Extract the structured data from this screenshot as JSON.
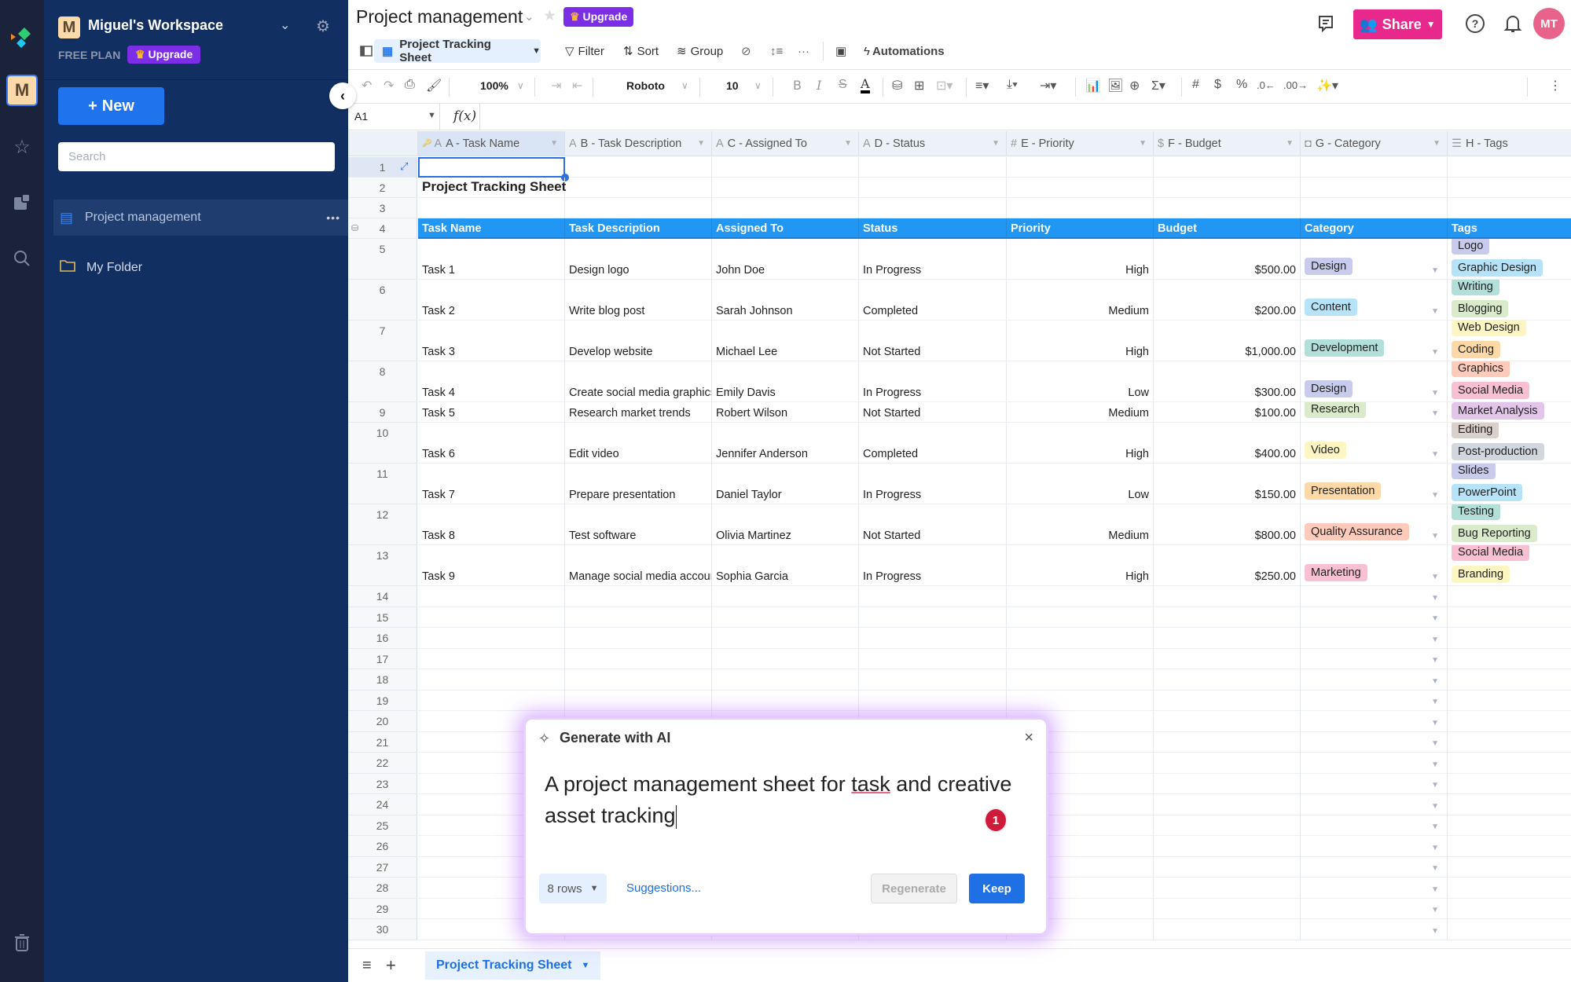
{
  "rail": {
    "logo_icon": "app-logo-icon",
    "workspace_initial": "M",
    "icons": [
      "star-icon",
      "puzzle-icon",
      "search-icon",
      "trash-icon"
    ]
  },
  "sidebar": {
    "workspace_initial": "M",
    "workspace_name": "Miguel's Workspace",
    "plan": "FREE PLAN",
    "upgrade_label": "Upgrade",
    "new_label": "New",
    "search_placeholder": "Search",
    "items": [
      {
        "label": "Project management",
        "icon": "book-icon",
        "selected": true,
        "more": "•••"
      },
      {
        "label": "My Folder",
        "icon": "folder-icon",
        "selected": false
      }
    ]
  },
  "header": {
    "title": "Project management",
    "upgrade_label": "Upgrade",
    "share_label": "Share",
    "avatar_initials": "MT",
    "colors": {
      "share": "#e8288c",
      "upgrade": "#7c2ee6",
      "avatar": "#e8638c"
    }
  },
  "viewbar": {
    "view_name": "Project Tracking Sheet",
    "filter_label": "Filter",
    "sort_label": "Sort",
    "group_label": "Group",
    "automations_label": "Automations"
  },
  "toolbar": {
    "zoom": "100%",
    "font": "Roboto",
    "font_size": "10"
  },
  "formula_bar": {
    "cell_ref": "A1",
    "fx_label": "f(x)",
    "value": ""
  },
  "grid": {
    "columns": [
      {
        "letter": "A",
        "label": "A - Task Name",
        "type_icon": "text-icon"
      },
      {
        "letter": "B",
        "label": "B - Task Description",
        "type_icon": "text-icon"
      },
      {
        "letter": "C",
        "label": "C - Assigned To",
        "type_icon": "text-icon"
      },
      {
        "letter": "D",
        "label": "D - Status",
        "type_icon": "text-icon"
      },
      {
        "letter": "E",
        "label": "E - Priority",
        "type_icon": "number-icon"
      },
      {
        "letter": "F",
        "label": "F - Budget",
        "type_icon": "currency-icon"
      },
      {
        "letter": "G",
        "label": "G - Category",
        "type_icon": "dropdown-icon"
      },
      {
        "letter": "H",
        "label": "H - Tags",
        "type_icon": "multiselect-icon"
      }
    ],
    "sheet_title": "Project Tracking Sheet",
    "header_row": [
      "Task Name",
      "Task Description",
      "Assigned To",
      "Status",
      "Priority",
      "Budget",
      "Category",
      "Tags"
    ],
    "rows": [
      {
        "task": "Task 1",
        "description": "Design logo",
        "assigned": "John Doe",
        "status": "In Progress",
        "priority": "High",
        "budget": "$500.00",
        "category": {
          "label": "Design",
          "color": "#c9cbec"
        },
        "tags": [
          {
            "label": "Logo",
            "color": "#c9cbec"
          },
          {
            "label": "Graphic Design",
            "color": "#b7e3f8"
          }
        ]
      },
      {
        "task": "Task 2",
        "description": "Write blog post",
        "assigned": "Sarah Johnson",
        "status": "Completed",
        "priority": "Medium",
        "budget": "$200.00",
        "category": {
          "label": "Content",
          "color": "#b7e3f8"
        },
        "tags": [
          {
            "label": "Writing",
            "color": "#b3dfd9"
          },
          {
            "label": "Blogging",
            "color": "#d9ebca"
          }
        ]
      },
      {
        "task": "Task 3",
        "description": "Develop website",
        "assigned": "Michael Lee",
        "status": "Not Started",
        "priority": "High",
        "budget": "$1,000.00",
        "category": {
          "label": "Development",
          "color": "#b3dfd9"
        },
        "tags": [
          {
            "label": "Web Design",
            "color": "#fdf5c2"
          },
          {
            "label": "Coding",
            "color": "#fed9a8"
          }
        ]
      },
      {
        "task": "Task 4",
        "description": "Create social media graphics",
        "assigned": "Emily Davis",
        "status": "In Progress",
        "priority": "Low",
        "budget": "$300.00",
        "category": {
          "label": "Design",
          "color": "#c9cbec"
        },
        "tags": [
          {
            "label": "Graphics",
            "color": "#fecbbb"
          },
          {
            "label": "Social Media",
            "color": "#f9c0d4"
          }
        ]
      },
      {
        "task": "Task 5",
        "description": "Research market trends",
        "assigned": "Robert Wilson",
        "status": "Not Started",
        "priority": "Medium",
        "budget": "$100.00",
        "category": {
          "label": "Research",
          "color": "#d9ebca"
        },
        "tags": [
          {
            "label": "Market Analysis",
            "color": "#e3c5ea"
          }
        ]
      },
      {
        "task": "Task 6",
        "description": "Edit video",
        "assigned": "Jennifer Anderson",
        "status": "Completed",
        "priority": "High",
        "budget": "$400.00",
        "category": {
          "label": "Video",
          "color": "#fdf5c2"
        },
        "tags": [
          {
            "label": "Editing",
            "color": "#d9cfcb"
          },
          {
            "label": "Post-production",
            "color": "#d2d7dd"
          }
        ]
      },
      {
        "task": "Task 7",
        "description": "Prepare presentation",
        "assigned": "Daniel Taylor",
        "status": "In Progress",
        "priority": "Low",
        "budget": "$150.00",
        "category": {
          "label": "Presentation",
          "color": "#fed9a8"
        },
        "tags": [
          {
            "label": "Slides",
            "color": "#c9cbec"
          },
          {
            "label": "PowerPoint",
            "color": "#b7e3f8"
          }
        ]
      },
      {
        "task": "Task 8",
        "description": "Test software",
        "assigned": "Olivia Martinez",
        "status": "Not Started",
        "priority": "Medium",
        "budget": "$800.00",
        "category": {
          "label": "Quality Assurance",
          "color": "#fecbbb"
        },
        "tags": [
          {
            "label": "Testing",
            "color": "#b3dfd9"
          },
          {
            "label": "Bug Reporting",
            "color": "#d9ebca"
          }
        ]
      },
      {
        "task": "Task 9",
        "description": "Manage social media accounts",
        "assigned": "Sophia Garcia",
        "status": "In Progress",
        "priority": "High",
        "budget": "$250.00",
        "category": {
          "label": "Marketing",
          "color": "#f9c0d4"
        },
        "tags": [
          {
            "label": "Social Media",
            "color": "#f9c0d4"
          },
          {
            "label": "Branding",
            "color": "#fdf5c2"
          }
        ]
      }
    ],
    "row_numbers": [
      "1",
      "2",
      "3",
      "4",
      "5",
      "6",
      "7",
      "8",
      "9",
      "10",
      "11",
      "12",
      "13",
      "14",
      "15",
      "16",
      "17",
      "18",
      "19",
      "20",
      "21",
      "22",
      "23",
      "24",
      "25",
      "26",
      "27",
      "28",
      "29",
      "30"
    ],
    "header_color": "#2196f3"
  },
  "bottom": {
    "sheet_tab": "Project Tracking Sheet"
  },
  "ai_modal": {
    "title": "Generate with AI",
    "prompt_before": "A project management sheet for ",
    "prompt_underlined": "task",
    "prompt_after": " and creative asset tracking",
    "badge_count": "1",
    "rows_option": "8 rows",
    "suggestions_label": "Suggestions...",
    "regenerate_label": "Regenerate",
    "keep_label": "Keep"
  }
}
